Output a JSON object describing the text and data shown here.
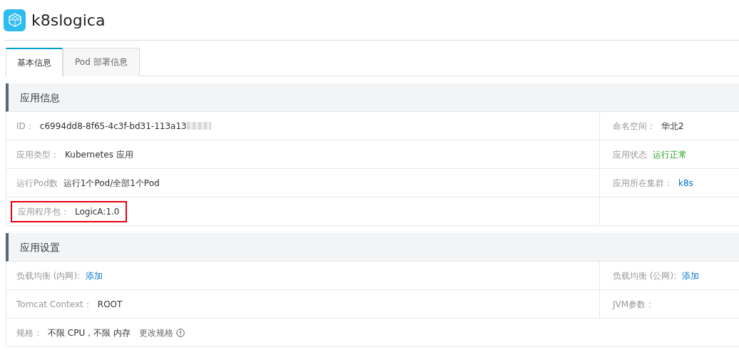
{
  "header": {
    "title": "k8slogica"
  },
  "tabs": [
    {
      "label": "基本信息",
      "selected": true
    },
    {
      "label": "Pod 部署信息",
      "selected": false
    }
  ],
  "sections": [
    {
      "title": "应用信息",
      "rows": [
        {
          "highlighted": false,
          "split": true,
          "left": {
            "label": "ID：",
            "value": "c6994dd8-8f65-4c3f-bd31-113a13",
            "kind": "text",
            "masked": true
          },
          "right": {
            "label": "命名空间：",
            "value": "华北2",
            "kind": "text"
          }
        },
        {
          "highlighted": false,
          "split": true,
          "left": {
            "label": "应用类型：",
            "value": "Kubernetes 应用",
            "kind": "text"
          },
          "right": {
            "label": "应用状态",
            "value": "运行正常",
            "kind": "success"
          }
        },
        {
          "highlighted": false,
          "split": true,
          "left": {
            "label": "运行Pod数",
            "value": "运行1个Pod/全部1个Pod",
            "kind": "text"
          },
          "right": {
            "label": "应用所在集群：",
            "value": "k8s",
            "kind": "link"
          }
        },
        {
          "highlighted": true,
          "split": true,
          "left": {
            "label": "应用程序包：",
            "value": "LogicA:1.0",
            "kind": "text"
          }
        }
      ]
    },
    {
      "title": "应用设置",
      "rows": [
        {
          "highlighted": false,
          "split": true,
          "left": {
            "label": "负载均衡 (内网):",
            "value": "添加",
            "kind": "link"
          },
          "right": {
            "label": "负载均衡 (公网):",
            "value": "添加",
            "kind": "link"
          }
        },
        {
          "highlighted": false,
          "split": true,
          "left": {
            "label": "Tomcat Context：",
            "value": "ROOT",
            "kind": "text"
          },
          "right": {
            "label": "JVM参数："
          }
        },
        {
          "highlighted": false,
          "split": false,
          "left": {
            "label": "规格：",
            "value": "不限 CPU，不限 内存",
            "kind": "text",
            "action": "更改规格",
            "info": true
          }
        }
      ]
    }
  ]
}
